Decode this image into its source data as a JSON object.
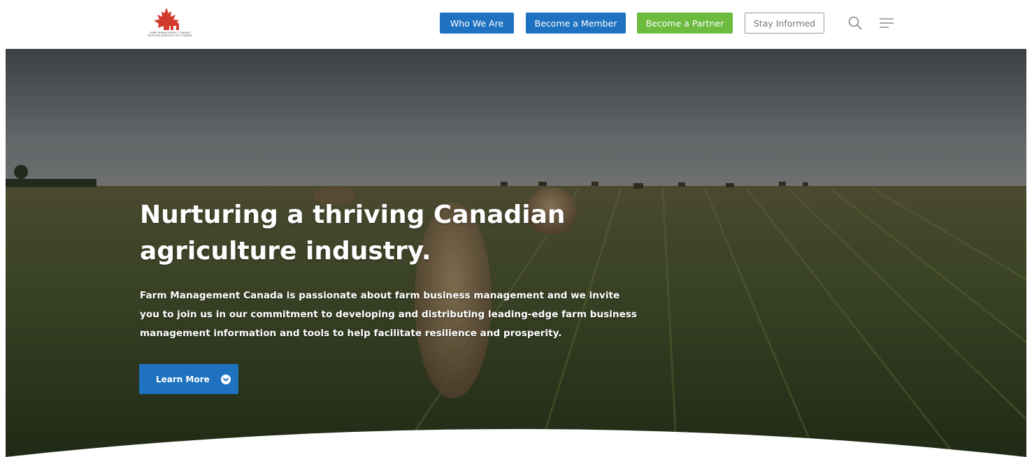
{
  "header": {
    "logo_text": [
      "FARM MANAGEMENT CANADA",
      "GESTION AGRICOLE DU CANADA"
    ],
    "nav": {
      "who_we_are": "Who We Are",
      "become_member": "Become a Member",
      "become_partner": "Become a Partner",
      "stay_informed": "Stay Informed"
    },
    "icons": {
      "search": "search-icon",
      "menu": "hamburger-menu-icon",
      "logo": "maple-leaf-logo"
    }
  },
  "hero": {
    "title": "Nurturing a thriving Canadian agriculture industry.",
    "description": "Farm Management Canada is passionate about farm business management and we invite you to join us in our commitment to developing and distributing leading-edge farm business management information and tools to help facilitate resilience and prosperity.",
    "cta_label": "Learn More",
    "cta_icon": "chevron-down-circle-icon"
  },
  "colors": {
    "primary_blue": "#1e72c0",
    "partner_green": "#6cba3e",
    "logo_red": "#d03a2a",
    "outline_gray": "#9a9a9a"
  }
}
